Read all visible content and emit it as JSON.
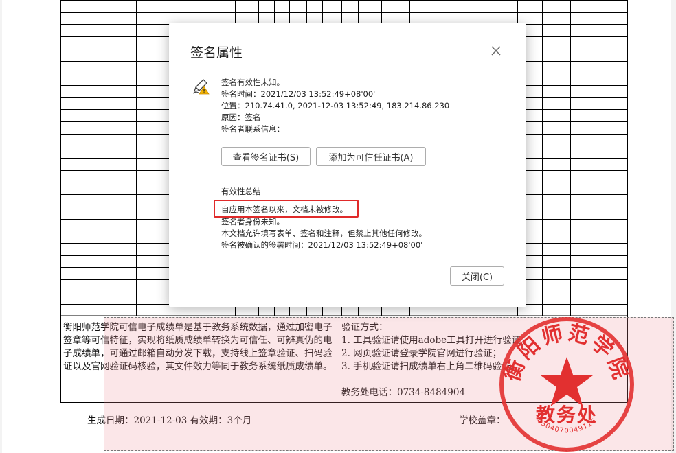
{
  "dialog": {
    "title": "签名属性",
    "status_line": "签名有效性未知。",
    "sign_time": "签名时间：2021/12/03 13:52:49+08'00'",
    "location": "位置：210.74.41.0, 2021-12-03 13:52:49, 183.214.86.230",
    "reason": "原因：签名",
    "contact": "签名者联系信息：",
    "view_cert_label": "查看签名证书(S)",
    "add_trusted_label": "添加为可信任证书(A)",
    "summary_heading": "有效性总结",
    "summary_lines": [
      "自应用本签名以来，文档未被修改。",
      "签名者身份未知。",
      "本文档允许填写表单、签名和注释，但禁止其他任何修改。",
      "签名被确认的签署时间：2021/12/03 13:52:49+08'00'"
    ],
    "close_label": "关闭(C)"
  },
  "document": {
    "notice": "衡阳师范学院可信电子成绩单是基于教务系统数据，通过加密电子签章等可信特征，实现将纸质成绩单转换为可信任、可辨真伪的电子成绩单，可通过邮箱自动分发下载，支持线上签章验证、扫码验证以及官网验证码核验，其文件效力等同于教务系统纸质成绩单。",
    "verify_title": "验证方式：",
    "verify_items": [
      "1. 工具验证请使用adobe工具打开进行验证；",
      "2. 网页验证请登录学院官网进行验证；",
      "3. 手机验证请扫成绩单右上角二维码验证。"
    ],
    "office_phone": "教务处电话：0734-8484904",
    "generated": "生成日期：2021-12-03  有效期：3个月",
    "seal_label": "学校盖章："
  },
  "seal": {
    "arc_text": "衡阳师范学院",
    "center_text": "教务处",
    "serial": "4304070049116",
    "color": "#e23030"
  },
  "colors": {
    "highlight": "#e02a2a",
    "signature_field": "#ec8c96"
  }
}
